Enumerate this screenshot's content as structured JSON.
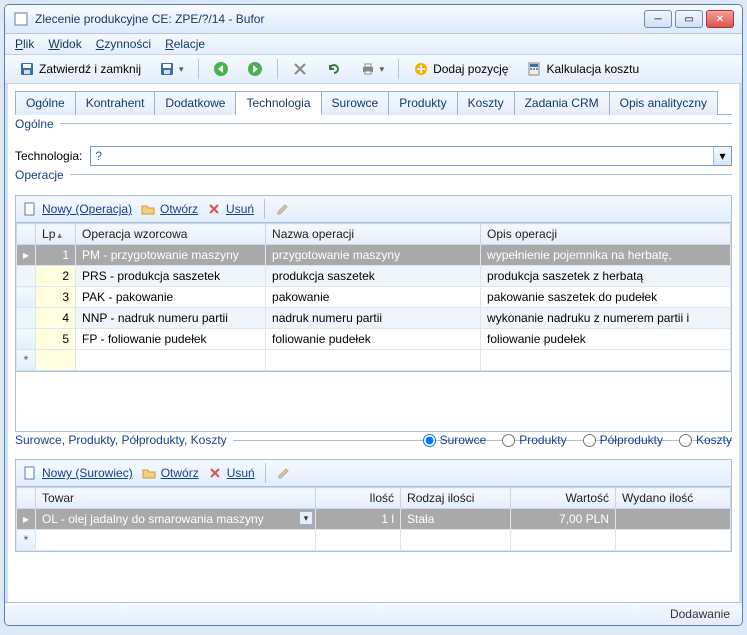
{
  "title": "Zlecenie produkcyjne CE: ZPE/?/14 - Bufor",
  "menu": {
    "file": "Plik",
    "view": "Widok",
    "actions": "Czynności",
    "relations": "Relacje"
  },
  "toolbar": {
    "approve": "Zatwierdź i zamknij",
    "addItem": "Dodaj pozycję",
    "costCalc": "Kalkulacja kosztu"
  },
  "tabs": [
    "Ogólne",
    "Kontrahent",
    "Dodatkowe",
    "Technologia",
    "Surowce",
    "Produkty",
    "Koszty",
    "Zadania CRM",
    "Opis analityczny"
  ],
  "activeTab": 3,
  "section": {
    "general": "Ogólne",
    "technologyLabel": "Technologia:",
    "technologyValue": "?",
    "operations": "Operacje",
    "resources": "Surowce, Produkty, Półprodukty, Koszty"
  },
  "opToolbar": {
    "new": "Nowy (Operacja)",
    "open": "Otwórz",
    "delete": "Usuń"
  },
  "opCols": {
    "lp": "Lp",
    "template": "Operacja wzorcowa",
    "name": "Nazwa operacji",
    "desc": "Opis operacji"
  },
  "ops": [
    {
      "lp": "1",
      "template": "PM - przygotowanie maszyny",
      "name": "przygotowanie maszyny",
      "desc": "wypełnienie pojemnika na herbatę,"
    },
    {
      "lp": "2",
      "template": "PRS - produkcja saszetek",
      "name": "produkcja saszetek",
      "desc": "produkcja saszetek z herbatą"
    },
    {
      "lp": "3",
      "template": "PAK - pakowanie",
      "name": "pakowanie",
      "desc": "pakowanie saszetek do pudełek"
    },
    {
      "lp": "4",
      "template": "NNP - nadruk numeru partii",
      "name": "nadruk numeru partii",
      "desc": "wykonanie nadruku z numerem partii i"
    },
    {
      "lp": "5",
      "template": "FP - foliowanie pudełek",
      "name": "foliowanie pudełek",
      "desc": "foliowanie pudełek"
    }
  ],
  "radios": {
    "surowce": "Surowce",
    "produkty": "Produkty",
    "polprodukty": "Półprodukty",
    "koszty": "Koszty"
  },
  "resToolbar": {
    "new": "Nowy (Surowiec)",
    "open": "Otwórz",
    "delete": "Usuń"
  },
  "resCols": {
    "towar": "Towar",
    "ilosc": "Ilość",
    "rodzaj": "Rodzaj ilości",
    "wartosc": "Wartość",
    "wydano": "Wydano ilość"
  },
  "res": [
    {
      "towar": "OL - olej jadalny do smarowania maszyny",
      "ilosc": "1 l",
      "rodzaj": "Stała",
      "wartosc": "7,00 PLN",
      "wydano": ""
    }
  ],
  "status": "Dodawanie",
  "icons": {
    "disk": "💾",
    "back": "◄",
    "forward": "►",
    "tools": "✕",
    "refresh": "⟳",
    "print": "🖶",
    "plus": "➕",
    "calc": "🧮",
    "page": "📄",
    "open": "📂",
    "del": "✖",
    "edit": "✎"
  }
}
